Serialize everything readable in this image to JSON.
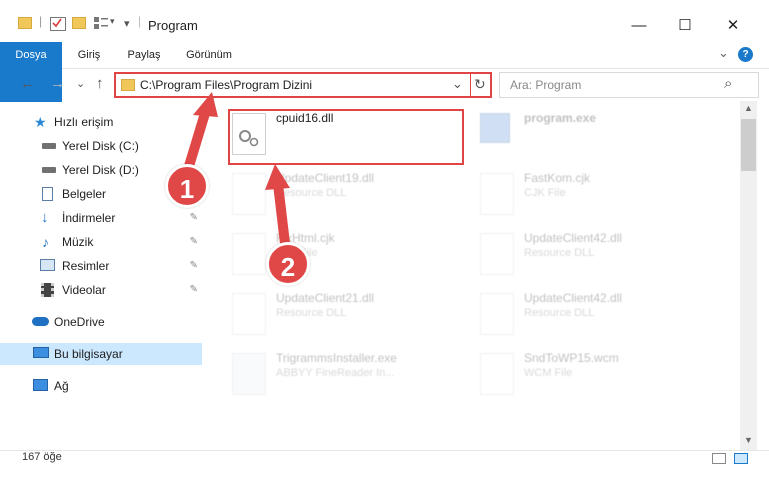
{
  "window": {
    "title": "Program",
    "minimize_label": "—",
    "maximize_label": "☐",
    "close_label": "✕",
    "qat_separator": "|",
    "qat_dropdown": "▾"
  },
  "ribbon": {
    "tabs": [
      "Dosya",
      "Giriş",
      "Paylaş",
      "Görünüm"
    ],
    "collapse_label": "⌄",
    "help_label": "?"
  },
  "address": {
    "path": "C:\\Program Files\\Program Dizini",
    "dropdown": "⌄",
    "refresh": "↻"
  },
  "search": {
    "placeholder": "Ara: Program",
    "icon": "⌕"
  },
  "nav": {
    "back": "←",
    "forward": "→",
    "recent": "⌄",
    "up": "↑"
  },
  "sidebar": {
    "items": [
      {
        "label": "Hızlı erişim",
        "icon": "star-icon"
      },
      {
        "label": "Yerel Disk (C:)",
        "icon": "drive-icon"
      },
      {
        "label": "Yerel Disk (D:)",
        "icon": "drive-icon"
      },
      {
        "label": "Belgeler",
        "icon": "document-icon"
      },
      {
        "label": "İndirmeler",
        "icon": "download-icon",
        "pinned": true
      },
      {
        "label": "Müzik",
        "icon": "music-icon",
        "pinned": true
      },
      {
        "label": "Resimler",
        "icon": "pictures-icon",
        "pinned": true
      },
      {
        "label": "Videolar",
        "icon": "video-icon",
        "pinned": true
      },
      {
        "label": "OneDrive",
        "icon": "cloud-icon"
      },
      {
        "label": "Bu bilgisayar",
        "icon": "computer-icon",
        "selected": true
      },
      {
        "label": "Ağ",
        "icon": "network-icon"
      }
    ],
    "pin_glyph": "📌"
  },
  "files": [
    {
      "name": "cpuid16.dll",
      "type": ""
    },
    {
      "name": "program.exe",
      "type": ""
    },
    {
      "name": "UpdateClient19.dll",
      "type": "Resource DLL"
    },
    {
      "name": "FastKom.cjk",
      "type": "CJK File"
    },
    {
      "name": "FixHtml.cjk",
      "type": "CJK File"
    },
    {
      "name": "UpdateClient42.dll",
      "type": "Resource DLL"
    },
    {
      "name": "UpdateClient21.dll",
      "type": "Resource DLL"
    },
    {
      "name": "UpdateClient42.dll",
      "type": "Resource DLL"
    },
    {
      "name": "TrigrammsInstaller.exe",
      "type": "ABBYY FineReader In..."
    },
    {
      "name": "SndToWP15.wcm",
      "type": "WCM File"
    }
  ],
  "status": {
    "count": "167 öğe"
  },
  "annotations": {
    "step1": "1",
    "step2": "2"
  },
  "colors": {
    "accent": "#1979ca",
    "highlight": "#e04444",
    "selected": "#cce8ff"
  }
}
